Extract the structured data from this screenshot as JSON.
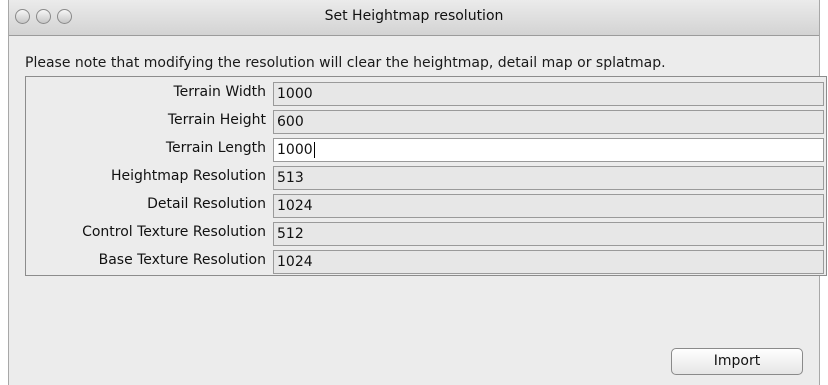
{
  "window": {
    "title": "Set Heightmap resolution"
  },
  "note": "Please note that modifying the resolution will clear the heightmap, detail map or splatmap.",
  "fields": [
    {
      "label": "Terrain Width",
      "value": "1000"
    },
    {
      "label": "Terrain Height",
      "value": "600"
    },
    {
      "label": "Terrain Length",
      "value": "1000"
    },
    {
      "label": "Heightmap Resolution",
      "value": "513"
    },
    {
      "label": "Detail Resolution",
      "value": "1024"
    },
    {
      "label": "Control Texture Resolution",
      "value": "512"
    },
    {
      "label": "Base Texture Resolution",
      "value": "1024"
    }
  ],
  "import_label": "Import",
  "icons": {
    "close": "close-light-icon",
    "minimize": "minimize-light-icon",
    "zoom": "zoom-light-icon"
  }
}
